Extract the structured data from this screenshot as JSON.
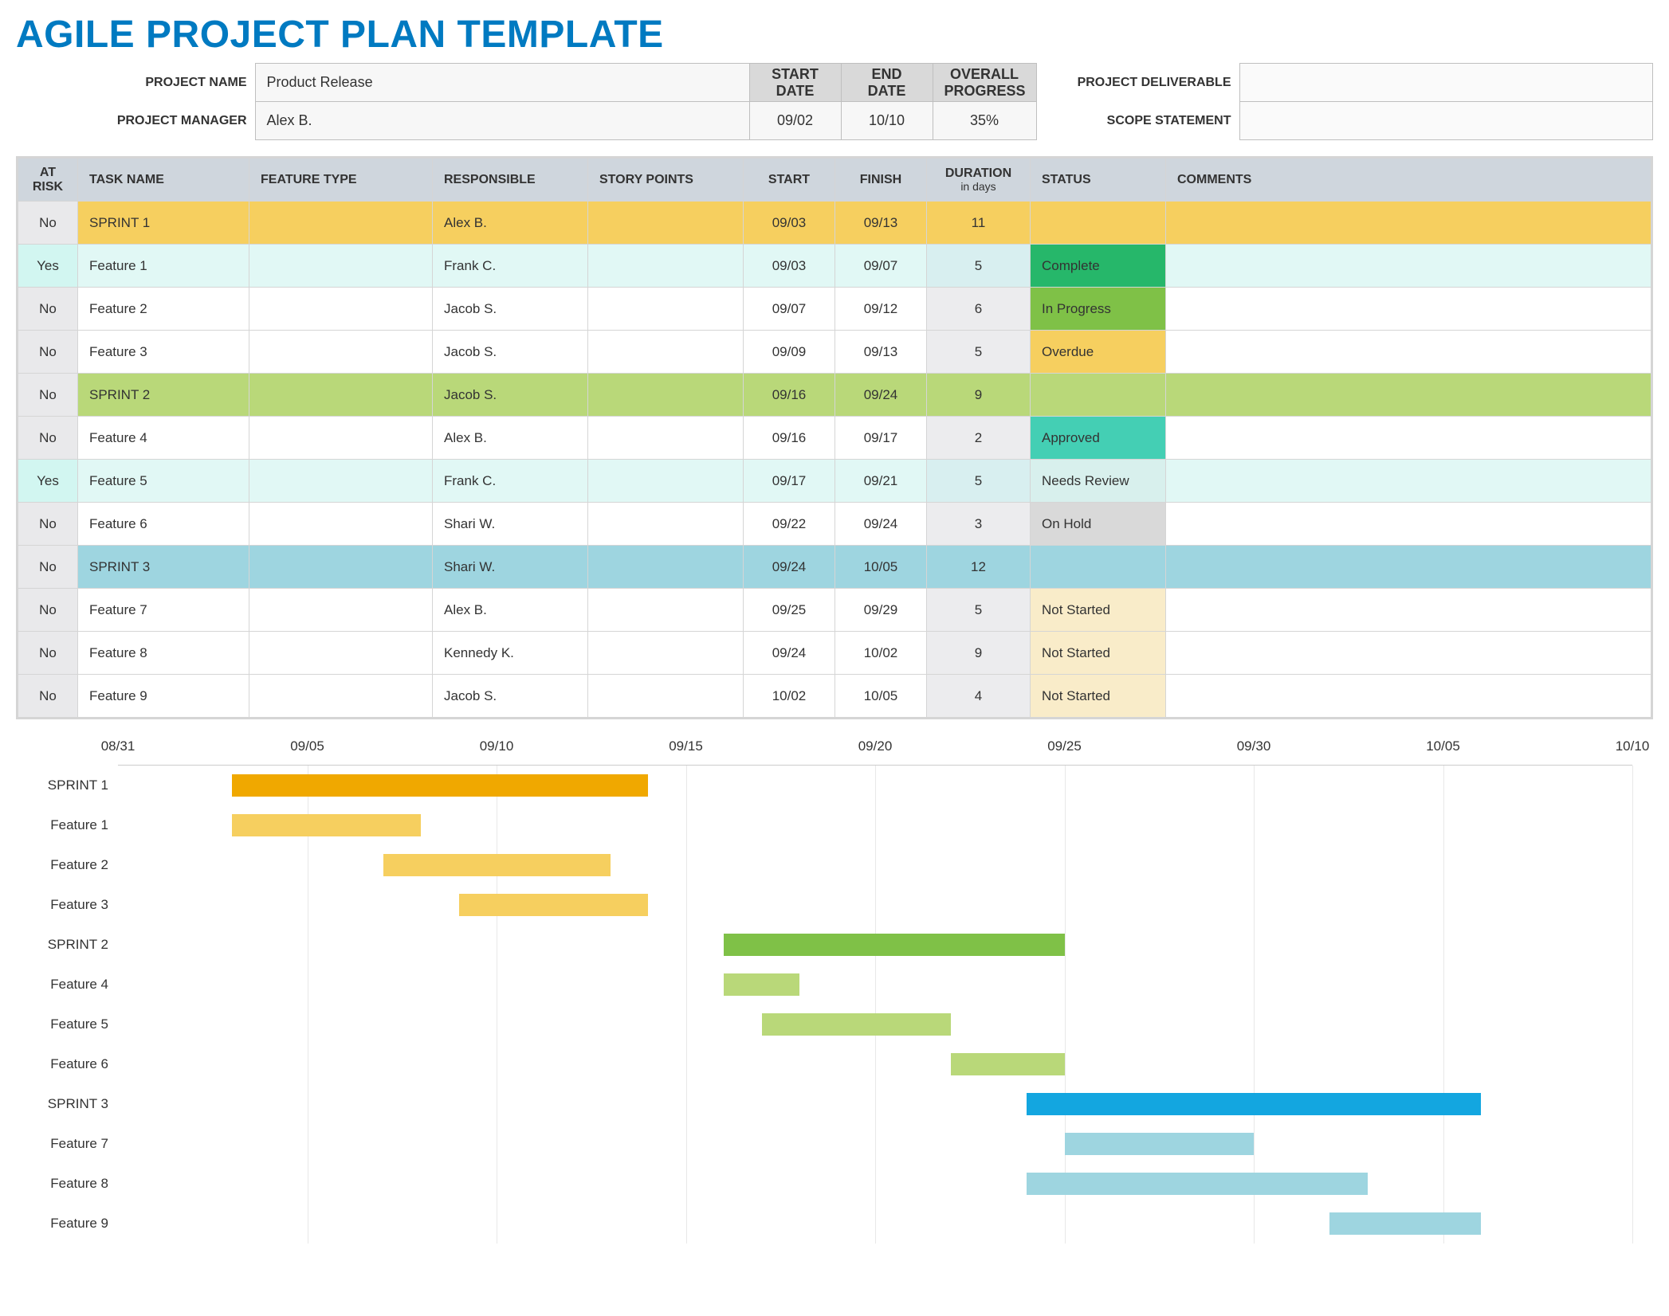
{
  "title": "AGILE PROJECT PLAN TEMPLATE",
  "info_labels": {
    "project_name": "PROJECT NAME",
    "project_manager": "PROJECT MANAGER",
    "start_date": "START DATE",
    "end_date": "END DATE",
    "overall_progress": "OVERALL PROGRESS",
    "project_deliverable": "PROJECT DELIVERABLE",
    "scope_statement": "SCOPE STATEMENT"
  },
  "info": {
    "project_name": "Product Release",
    "project_manager": "Alex B.",
    "start_date": "09/02",
    "end_date": "10/10",
    "overall_progress": "35%",
    "project_deliverable": "",
    "scope_statement": ""
  },
  "columns": {
    "at_risk": "AT RISK",
    "task_name": "TASK NAME",
    "feature_type": "FEATURE TYPE",
    "responsible": "RESPONSIBLE",
    "story_points": "STORY POINTS",
    "start": "START",
    "finish": "FINISH",
    "duration": "DURATION",
    "duration_sub": "in days",
    "status": "STATUS",
    "comments": "COMMENTS"
  },
  "rows": [
    {
      "type": "sprint",
      "sprint": 1,
      "at_risk": "No",
      "task": "SPRINT 1",
      "responsible": "Alex B.",
      "start": "09/03",
      "finish": "09/13",
      "duration": "11",
      "status": ""
    },
    {
      "type": "feature",
      "sprint": 1,
      "at_risk": "Yes",
      "task": "Feature 1",
      "responsible": "Frank C.",
      "start": "09/03",
      "finish": "09/07",
      "duration": "5",
      "status": "Complete"
    },
    {
      "type": "feature",
      "sprint": 1,
      "at_risk": "No",
      "task": "Feature 2",
      "responsible": "Jacob S.",
      "start": "09/07",
      "finish": "09/12",
      "duration": "6",
      "status": "In Progress"
    },
    {
      "type": "feature",
      "sprint": 1,
      "at_risk": "No",
      "task": "Feature 3",
      "responsible": "Jacob S.",
      "start": "09/09",
      "finish": "09/13",
      "duration": "5",
      "status": "Overdue"
    },
    {
      "type": "sprint",
      "sprint": 2,
      "at_risk": "No",
      "task": "SPRINT 2",
      "responsible": "Jacob S.",
      "start": "09/16",
      "finish": "09/24",
      "duration": "9",
      "status": ""
    },
    {
      "type": "feature",
      "sprint": 2,
      "at_risk": "No",
      "task": "Feature 4",
      "responsible": "Alex B.",
      "start": "09/16",
      "finish": "09/17",
      "duration": "2",
      "status": "Approved"
    },
    {
      "type": "feature",
      "sprint": 2,
      "at_risk": "Yes",
      "task": "Feature 5",
      "responsible": "Frank C.",
      "start": "09/17",
      "finish": "09/21",
      "duration": "5",
      "status": "Needs Review"
    },
    {
      "type": "feature",
      "sprint": 2,
      "at_risk": "No",
      "task": "Feature 6",
      "responsible": "Shari W.",
      "start": "09/22",
      "finish": "09/24",
      "duration": "3",
      "status": "On Hold"
    },
    {
      "type": "sprint",
      "sprint": 3,
      "at_risk": "No",
      "task": "SPRINT 3",
      "responsible": "Shari W.",
      "start": "09/24",
      "finish": "10/05",
      "duration": "12",
      "status": ""
    },
    {
      "type": "feature",
      "sprint": 3,
      "at_risk": "No",
      "task": "Feature 7",
      "responsible": "Alex B.",
      "start": "09/25",
      "finish": "09/29",
      "duration": "5",
      "status": "Not Started"
    },
    {
      "type": "feature",
      "sprint": 3,
      "at_risk": "No",
      "task": "Feature 8",
      "responsible": "Kennedy K.",
      "start": "09/24",
      "finish": "10/02",
      "duration": "9",
      "status": "Not Started"
    },
    {
      "type": "feature",
      "sprint": 3,
      "at_risk": "No",
      "task": "Feature 9",
      "responsible": "Jacob S.",
      "start": "10/02",
      "finish": "10/05",
      "duration": "4",
      "status": "Not Started"
    }
  ],
  "chart_data": {
    "type": "gantt",
    "x_ticks": [
      "08/31",
      "09/05",
      "09/10",
      "09/15",
      "09/20",
      "09/25",
      "09/30",
      "10/05",
      "10/10"
    ],
    "x_range_days": {
      "start": "08/31",
      "end": "10/10",
      "total": 40
    },
    "series": [
      {
        "name": "SPRINT 1",
        "start_day": 3,
        "duration": 11,
        "color": "#f0a800"
      },
      {
        "name": "Feature 1",
        "start_day": 3,
        "duration": 5,
        "color": "#f6cf5f"
      },
      {
        "name": "Feature 2",
        "start_day": 7,
        "duration": 6,
        "color": "#f6cf5f"
      },
      {
        "name": "Feature 3",
        "start_day": 9,
        "duration": 5,
        "color": "#f6cf5f"
      },
      {
        "name": "SPRINT 2",
        "start_day": 16,
        "duration": 9,
        "color": "#7fc147"
      },
      {
        "name": "Feature 4",
        "start_day": 16,
        "duration": 2,
        "color": "#b9d879"
      },
      {
        "name": "Feature 5",
        "start_day": 17,
        "duration": 5,
        "color": "#b9d879"
      },
      {
        "name": "Feature 6",
        "start_day": 22,
        "duration": 3,
        "color": "#b9d879"
      },
      {
        "name": "SPRINT 3",
        "start_day": 24,
        "duration": 12,
        "color": "#13a6e0"
      },
      {
        "name": "Feature 7",
        "start_day": 25,
        "duration": 5,
        "color": "#9ed5e0"
      },
      {
        "name": "Feature 8",
        "start_day": 24,
        "duration": 9,
        "color": "#9ed5e0"
      },
      {
        "name": "Feature 9",
        "start_day": 32,
        "duration": 4,
        "color": "#9ed5e0"
      }
    ]
  }
}
